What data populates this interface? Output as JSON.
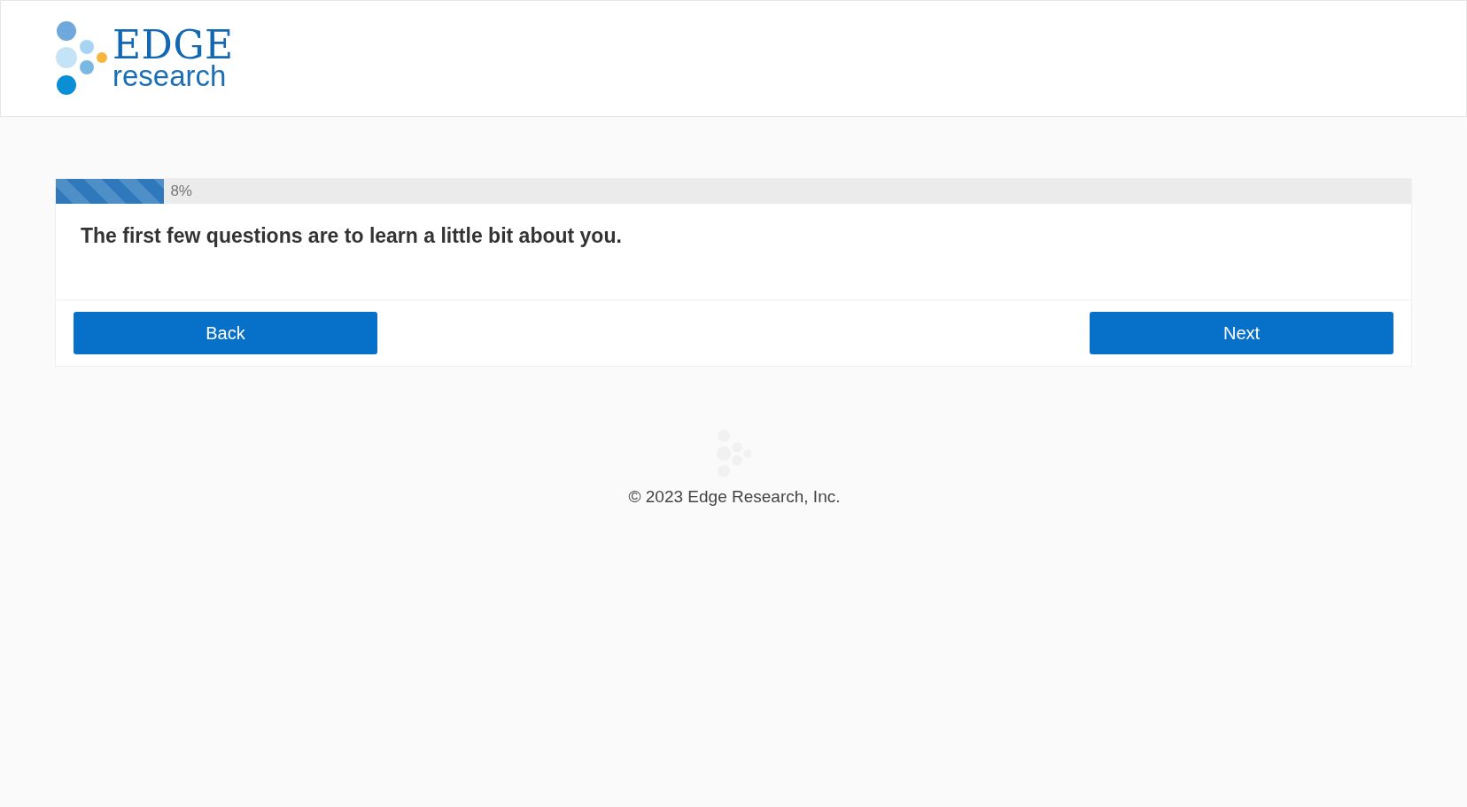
{
  "header": {
    "logo": {
      "name": "EDGE",
      "tagline": "research"
    }
  },
  "progress": {
    "level": 0.08,
    "reading": "8%"
  },
  "question": {
    "text": "The first few questions are to learn a little bit about you."
  },
  "buttons": [
    {
      "label": "Back"
    },
    {
      "label": "Next"
    }
  ],
  "footer": {
    "copyright": "© 2023 Edge Research, Inc."
  }
}
